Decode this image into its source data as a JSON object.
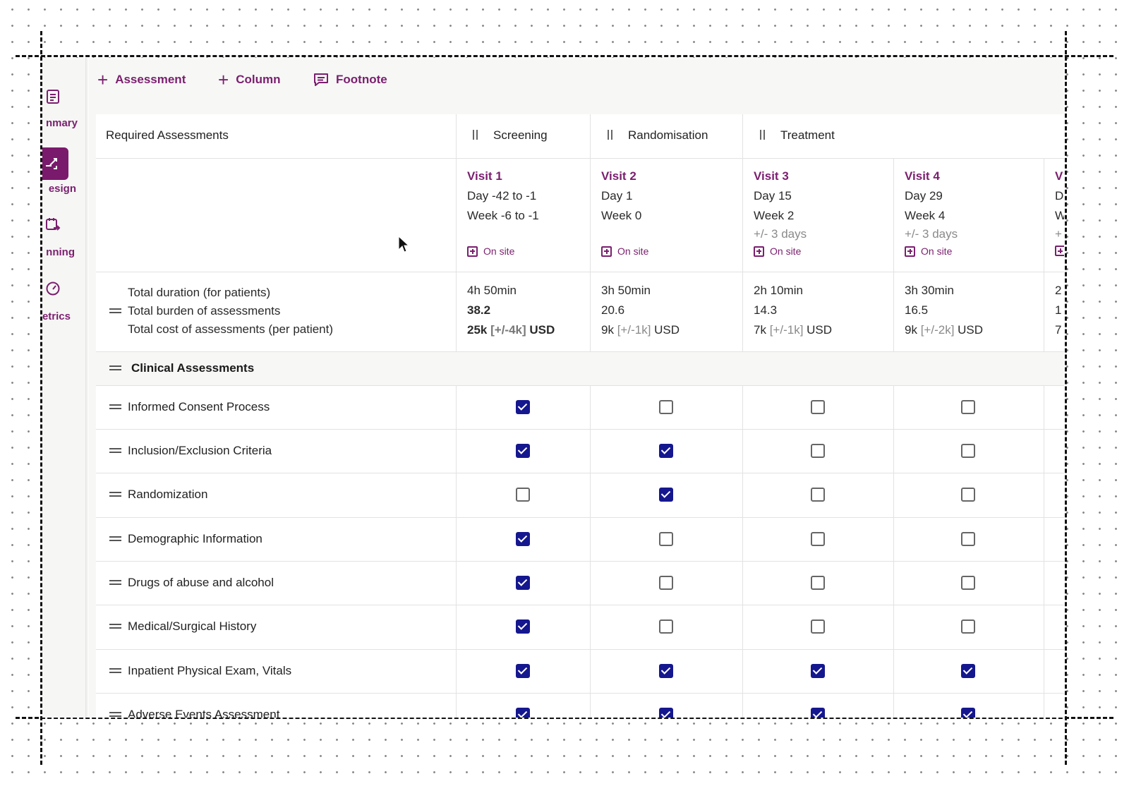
{
  "toolbar": {
    "add_assessment": "Assessment",
    "add_column": "Column",
    "add_footnote": "Footnote"
  },
  "rail": {
    "items": [
      {
        "label": "nmary",
        "icon": "document-list-icon"
      },
      {
        "label": "esign",
        "icon": "shuffle-icon"
      },
      {
        "label": "nning",
        "icon": "calendar-arrow-icon"
      },
      {
        "label": "etrics",
        "icon": "gauge-icon"
      }
    ]
  },
  "table": {
    "corner_header": "Required Assessments",
    "phases": [
      {
        "label": "Screening"
      },
      {
        "label": "Randomisation"
      },
      {
        "label": "Treatment"
      }
    ],
    "visits": [
      {
        "title": "Visit 1",
        "day": "Day -42 to -1",
        "week": "Week -6 to -1",
        "tolerance": "",
        "location": "On site"
      },
      {
        "title": "Visit 2",
        "day": "Day 1",
        "week": "Week 0",
        "tolerance": "",
        "location": "On site"
      },
      {
        "title": "Visit 3",
        "day": "Day 15",
        "week": "Week 2",
        "tolerance": "+/- 3 days",
        "location": "On site"
      },
      {
        "title": "Visit 4",
        "day": "Day 29",
        "week": "Week 4",
        "tolerance": "+/- 3 days",
        "location": "On site"
      },
      {
        "title": "V",
        "day": "D",
        "week": "W",
        "tolerance": "+",
        "location": ""
      }
    ],
    "totals": {
      "labels": [
        "Total duration (for patients)",
        "Total burden of assessments",
        "Total cost of assessments (per patient)"
      ],
      "values": [
        {
          "duration": "4h 50min",
          "burden": "38.2",
          "cost": "25k",
          "range": "[+/-4k]",
          "currency": "USD"
        },
        {
          "duration": "3h 50min",
          "burden": "20.6",
          "cost": "9k",
          "range": "[+/-1k]",
          "currency": "USD"
        },
        {
          "duration": "2h 10min",
          "burden": "14.3",
          "cost": "7k",
          "range": "[+/-1k]",
          "currency": "USD"
        },
        {
          "duration": "3h 30min",
          "burden": "16.5",
          "cost": "9k",
          "range": "[+/-2k]",
          "currency": "USD"
        },
        {
          "duration": "2",
          "burden": "1",
          "cost": "7",
          "range": "",
          "currency": ""
        }
      ]
    },
    "section": "Clinical Assessments",
    "rows": [
      {
        "label": "Informed Consent Process",
        "checks": [
          true,
          false,
          false,
          false
        ]
      },
      {
        "label": "Inclusion/Exclusion Criteria",
        "checks": [
          true,
          true,
          false,
          false
        ]
      },
      {
        "label": "Randomization",
        "checks": [
          false,
          true,
          false,
          false
        ]
      },
      {
        "label": "Demographic Information",
        "checks": [
          true,
          false,
          false,
          false
        ]
      },
      {
        "label": "Drugs of abuse and alcohol",
        "checks": [
          true,
          false,
          false,
          false
        ]
      },
      {
        "label": "Medical/Surgical History",
        "checks": [
          true,
          false,
          false,
          false
        ]
      },
      {
        "label": "Inpatient Physical Exam, Vitals",
        "checks": [
          true,
          true,
          true,
          true
        ]
      },
      {
        "label": "Adverse Events Assessment",
        "checks": [
          true,
          true,
          true,
          true
        ]
      }
    ]
  },
  "colors": {
    "accent": "#7a1f6e",
    "checkbox": "#15178f"
  }
}
